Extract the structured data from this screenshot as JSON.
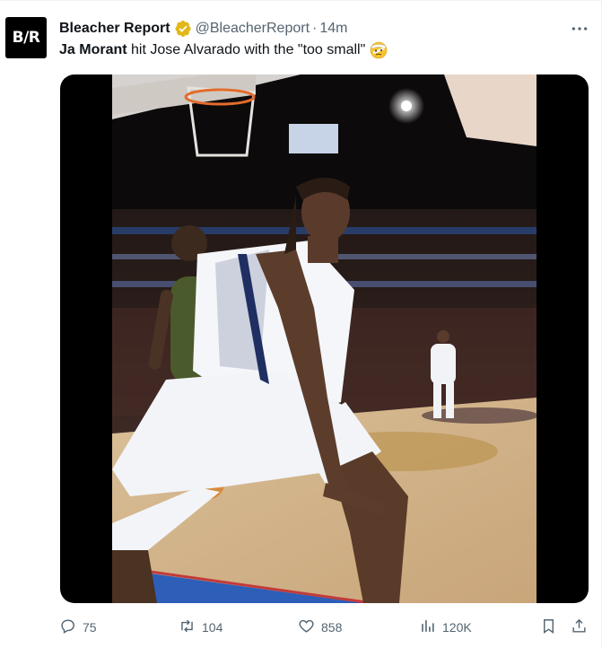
{
  "tweet": {
    "avatar_text": "B/R",
    "display_name": "Bleacher Report",
    "handle": "@BleacherReport",
    "separator": "·",
    "time": "14m",
    "mention": "Ja Morant",
    "text": " hit Jose Alvarado with the \"too small\"",
    "emoji_icon": "face-with-head-bandage-icon"
  },
  "media": {
    "type": "video"
  },
  "actions": {
    "replies": "75",
    "retweets": "104",
    "likes": "858",
    "views": "120K"
  },
  "colors": {
    "muted": "#536471",
    "verified_gold": "#e2b719",
    "text": "#0f1419"
  }
}
